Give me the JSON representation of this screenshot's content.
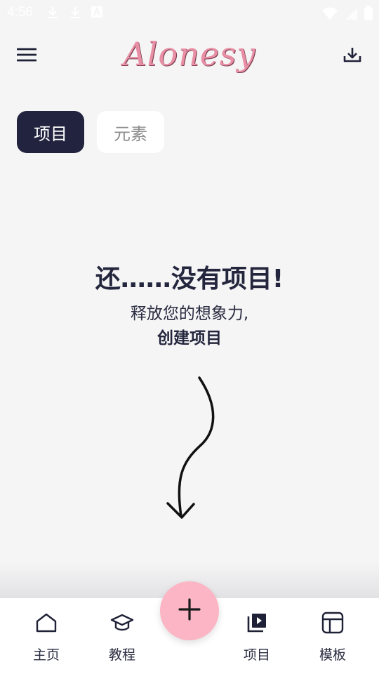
{
  "status_bar": {
    "time": "4:56",
    "icons_left": [
      "download-icon",
      "download-icon",
      "app-icon"
    ],
    "icons_right": [
      "wifi-icon",
      "signal-icon",
      "battery-icon"
    ]
  },
  "app_bar": {
    "logo_text": "Alonesy",
    "logo_color": "#e88ea5",
    "menu_icon": "menu-icon",
    "download_icon": "download-icon"
  },
  "segments": {
    "active": "项目",
    "inactive": "元素",
    "active_bg": "#22243f"
  },
  "empty_state": {
    "title": "还……没有项目!",
    "subtitle": "释放您的想象力,",
    "cta": "创建项目"
  },
  "bottom_nav": {
    "items": [
      {
        "label": "主页",
        "icon": "home-icon"
      },
      {
        "label": "教程",
        "icon": "graduation-cap-icon"
      },
      {
        "label": "项目",
        "icon": "video-library-icon"
      },
      {
        "label": "模板",
        "icon": "template-icon"
      }
    ]
  },
  "fab": {
    "icon": "plus-icon",
    "color": "#fbb5c4"
  }
}
